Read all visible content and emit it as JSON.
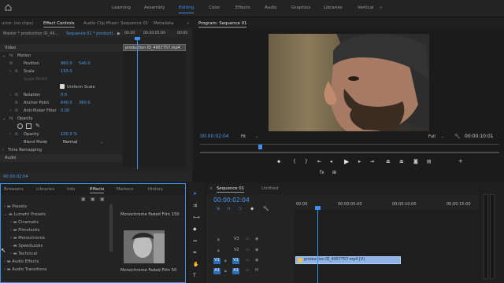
{
  "workspaces": [
    "Learning",
    "Assembly",
    "Editing",
    "Color",
    "Effects",
    "Audio",
    "Graphics",
    "Libraries",
    "Vertical"
  ],
  "active_workspace": "Editing",
  "source_panel": {
    "tabs": [
      "urce: (no clips)",
      "Effect Controls",
      "Audio Clip Mixer: Sequence 01",
      "Metadata"
    ],
    "active_tab": "Effect Controls",
    "master_label": "Master * production ID_49...",
    "sequence_label": "Sequence 01 * producti...",
    "ruler_times": [
      "00:00",
      "00:00:05:00",
      "00:00"
    ],
    "clip_name": "production ID_4957757.mp4",
    "video_header": "Video",
    "motion": {
      "label": "Motion",
      "position_label": "Position",
      "position_x": "960.0",
      "position_y": "540.0",
      "scale_label": "Scale",
      "scale": "150.0",
      "scale_width_label": "Scale Width",
      "uniform_scale_label": "Uniform Scale",
      "rotation_label": "Rotation",
      "rotation": "0.0",
      "anchor_label": "Anchor Point",
      "anchor_x": "640.0",
      "anchor_y": "360.0",
      "antiflicker_label": "Anti-flicker Filter",
      "antiflicker": "0.00"
    },
    "opacity": {
      "label": "Opacity",
      "opacity_label": "Opacity",
      "opacity": "100.0 %",
      "blend_label": "Blend Mode",
      "blend": "Normal"
    },
    "time_remapping": "Time Remapping",
    "audio_header": "Audio",
    "timecode": "00:00:02:04"
  },
  "program_panel": {
    "title": "Program: Sequence 01",
    "timecode": "00:00:02:04",
    "fit": "Fit",
    "quality": "Full",
    "duration": "00:00:10:01",
    "playhead_fraction": 0.2
  },
  "effects_panel": {
    "tabs": [
      "Browsers",
      "Libraries",
      "Info",
      "Effects",
      "Markers",
      "History"
    ],
    "active_tab": "Effects",
    "tree": [
      {
        "label": "Presets",
        "level": 0
      },
      {
        "label": "Lumetri Presets",
        "level": 0
      },
      {
        "label": "Cinematic",
        "level": 1
      },
      {
        "label": "Filmstocks",
        "level": 1
      },
      {
        "label": "Monochrome",
        "level": 1
      },
      {
        "label": "SpeedLooks",
        "level": 1
      },
      {
        "label": "Technical",
        "level": 1
      },
      {
        "label": "Audio Effects",
        "level": 0
      },
      {
        "label": "Audio Transitions",
        "level": 0
      }
    ],
    "preview1_label": "Monochrome Faded Film 150",
    "preview2_label": "Monochrome Faded Film 50"
  },
  "timeline_panel": {
    "tabs": [
      "Sequence 01",
      "Untitled"
    ],
    "active_tab": "Sequence 01",
    "timecode": "00:00:02:04",
    "ruler_times": [
      "00:00",
      "00:00:05:00",
      "00:00:10:00",
      "00:00:15:00"
    ],
    "tracks": [
      {
        "target": "",
        "name": "V3"
      },
      {
        "target": "",
        "name": "V2"
      },
      {
        "target": "V1",
        "name": "V1"
      },
      {
        "target": "A1",
        "name": "A1"
      }
    ],
    "clip_name": "production ID_4957757.mp4 [V]"
  },
  "colors": {
    "accent": "#3d8ff0",
    "panel": "#232323",
    "clip": "#8fb3e6",
    "value_blue": "#4b9ae8"
  }
}
